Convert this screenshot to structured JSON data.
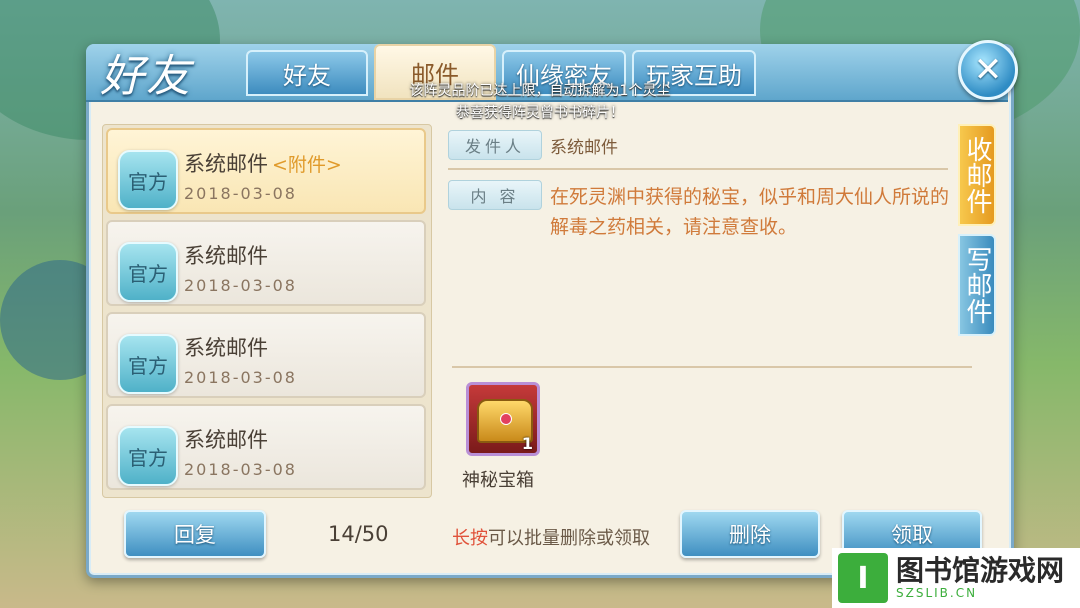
{
  "header": {
    "logo": "好友",
    "tabs": [
      {
        "label": "好友",
        "active": false
      },
      {
        "label": "邮件",
        "active": true
      },
      {
        "label": "仙缘密友",
        "active": false
      },
      {
        "label": "玩家互助",
        "active": false
      }
    ]
  },
  "notices": [
    "该阵灵品阶已达上限，自动拆解为1个灵尘",
    "恭喜获得阵灵曾书书碎片！"
  ],
  "mail_list": [
    {
      "badge": "官方",
      "title": "系统邮件",
      "attachment": "<附件>",
      "date": "2018-03-08",
      "selected": true
    },
    {
      "badge": "官方",
      "title": "系统邮件",
      "attachment": "",
      "date": "2018-03-08",
      "selected": false
    },
    {
      "badge": "官方",
      "title": "系统邮件",
      "attachment": "",
      "date": "2018-03-08",
      "selected": false
    },
    {
      "badge": "官方",
      "title": "系统邮件",
      "attachment": "",
      "date": "2018-03-08",
      "selected": false
    }
  ],
  "detail": {
    "sender_label": "发件人",
    "sender_value": "系统邮件",
    "content_label": "内 容",
    "content_text": "在死灵渊中获得的秘宝，似乎和周大仙人所说的解毒之药相关，请注意查收。",
    "attachment_item": {
      "name": "神秘宝箱",
      "count": "1"
    }
  },
  "side_tabs": {
    "inbox": "收邮件",
    "compose": "写邮件"
  },
  "footer": {
    "reply_label": "回复",
    "page_count": "14/50",
    "hint_emphasis": "长按",
    "hint_rest": "可以批量删除或领取",
    "delete_label": "删除",
    "claim_label": "领取"
  },
  "watermark": {
    "logo": "I",
    "title": "图书馆游戏网",
    "subtitle": "SZSLIB.CN"
  },
  "colors": {
    "accent_blue": "#3f8fc1",
    "selected_item": "#f9e6b4",
    "content_text": "#d07a3a",
    "active_side_tab": "#e59a20"
  }
}
